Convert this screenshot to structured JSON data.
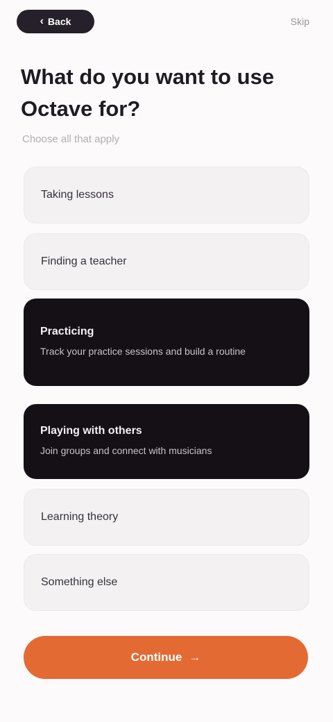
{
  "header": {
    "back_label": "Back",
    "back_icon": "chevron-left-icon",
    "skip_label": "Skip"
  },
  "page": {
    "title": "What do you want to use Octave for?",
    "subtitle": "Choose all that apply"
  },
  "options": [
    {
      "label": "Taking lessons",
      "selected": false
    },
    {
      "label": "Finding a teacher",
      "selected": false
    },
    {
      "label": "Practicing",
      "description": "Track your practice sessions and build a routine",
      "selected": true
    },
    {
      "label": "Playing with others",
      "description": "Join groups and connect with musicians",
      "selected": true
    },
    {
      "label": "Learning theory",
      "selected": false
    },
    {
      "label": "Something else",
      "selected": false
    }
  ],
  "footer": {
    "continue_label": "Continue",
    "continue_icon": "arrow-right-icon"
  },
  "colors": {
    "background": "#fcfafb",
    "dark": "#141016",
    "accent": "#e46a33",
    "option_bg": "#f4f1f2"
  }
}
